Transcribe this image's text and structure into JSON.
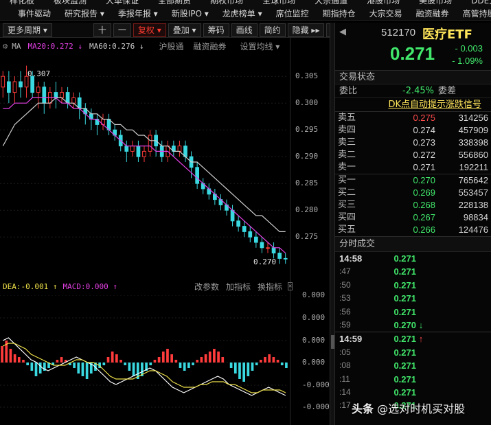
{
  "menu": {
    "row1": [
      "样化板",
      "板块监测",
      "大单保证",
      "全部期货",
      "期权市场",
      "全球市场",
      "大宗通道",
      "港股市场",
      "美股市场",
      "DDE大单"
    ],
    "row2": [
      "事件驱动",
      "研究报告 ▾",
      "季报年报 ▾",
      "新股IPO ▾",
      "龙虎榜单 ▾",
      "席位监控",
      "期指持仓",
      "大宗交易",
      "融资融券",
      "高管持股"
    ]
  },
  "toolbar": {
    "period": "更多周期 ▾",
    "plus": "十",
    "minus": "一",
    "fuquan": "复权 ▾",
    "overlay": "叠加 ▾",
    "chips": "筹码",
    "draw": "画线",
    "simple": "简约",
    "hide": "隐藏 ▸▸",
    "expand": "⛶"
  },
  "ma_legend": {
    "label": "MA",
    "ma20": "MA20:0.272 ↓",
    "ma60": "MA60:0.276 ↓",
    "tabs": [
      "沪股通",
      "融资融券",
      "设置均线 ▾"
    ]
  },
  "kline": {
    "high_label": "0.307",
    "low_label": "0.270",
    "yticks": [
      "0.305",
      "0.300",
      "0.295",
      "0.290",
      "0.285",
      "0.280",
      "0.275"
    ],
    "ma20": [
      0.299,
      0.299,
      0.3,
      0.3,
      0.3,
      0.301,
      0.301,
      0.301,
      0.301,
      0.301,
      0.3,
      0.3,
      0.299,
      0.299,
      0.298,
      0.297,
      0.297,
      0.296,
      0.295,
      0.294,
      0.293,
      0.292,
      0.292,
      0.292,
      0.292,
      0.292,
      0.291,
      0.291,
      0.291,
      0.29,
      0.289,
      0.288,
      0.287,
      0.286,
      0.285,
      0.284,
      0.283,
      0.282,
      0.281,
      0.28,
      0.279,
      0.278,
      0.277,
      0.276,
      0.275,
      0.274,
      0.273,
      0.273,
      0.272
    ],
    "ma60": [
      0.292,
      0.294,
      0.296,
      0.297,
      0.298,
      0.299,
      0.3,
      0.3,
      0.3,
      0.301,
      0.301,
      0.3,
      0.3,
      0.299,
      0.299,
      0.298,
      0.298,
      0.297,
      0.297,
      0.296,
      0.296,
      0.295,
      0.295,
      0.294,
      0.294,
      0.293,
      0.293,
      0.292,
      0.292,
      0.291,
      0.291,
      0.29,
      0.289,
      0.289,
      0.288,
      0.287,
      0.286,
      0.285,
      0.284,
      0.283,
      0.282,
      0.281,
      0.28,
      0.279,
      0.279,
      0.278,
      0.277,
      0.276,
      0.276
    ],
    "candles": [
      [
        0.303,
        0.305,
        0.301,
        0.306,
        0
      ],
      [
        0.304,
        0.302,
        0.3,
        0.306,
        1
      ],
      [
        0.302,
        0.304,
        0.3,
        0.305,
        0
      ],
      [
        0.304,
        0.303,
        0.301,
        0.306,
        1
      ],
      [
        0.303,
        0.305,
        0.301,
        0.307,
        0
      ],
      [
        0.305,
        0.302,
        0.301,
        0.306,
        1
      ],
      [
        0.302,
        0.303,
        0.299,
        0.304,
        0
      ],
      [
        0.303,
        0.3,
        0.298,
        0.304,
        1
      ],
      [
        0.3,
        0.302,
        0.299,
        0.303,
        0
      ],
      [
        0.302,
        0.301,
        0.299,
        0.304,
        1
      ],
      [
        0.301,
        0.302,
        0.3,
        0.303,
        0
      ],
      [
        0.302,
        0.3,
        0.299,
        0.303,
        1
      ],
      [
        0.3,
        0.301,
        0.299,
        0.302,
        0
      ],
      [
        0.301,
        0.299,
        0.297,
        0.302,
        1
      ],
      [
        0.299,
        0.298,
        0.296,
        0.3,
        1
      ],
      [
        0.298,
        0.297,
        0.295,
        0.299,
        1
      ],
      [
        0.297,
        0.296,
        0.294,
        0.298,
        1
      ],
      [
        0.296,
        0.297,
        0.295,
        0.298,
        0
      ],
      [
        0.297,
        0.295,
        0.294,
        0.298,
        1
      ],
      [
        0.295,
        0.294,
        0.293,
        0.296,
        1
      ],
      [
        0.294,
        0.292,
        0.291,
        0.295,
        1
      ],
      [
        0.292,
        0.291,
        0.289,
        0.293,
        1
      ],
      [
        0.291,
        0.292,
        0.29,
        0.293,
        0
      ],
      [
        0.292,
        0.29,
        0.289,
        0.293,
        1
      ],
      [
        0.29,
        0.291,
        0.289,
        0.292,
        0
      ],
      [
        0.291,
        0.294,
        0.29,
        0.295,
        0
      ],
      [
        0.294,
        0.292,
        0.29,
        0.295,
        1
      ],
      [
        0.292,
        0.29,
        0.289,
        0.293,
        1
      ],
      [
        0.29,
        0.292,
        0.289,
        0.293,
        0
      ],
      [
        0.292,
        0.291,
        0.29,
        0.293,
        1
      ],
      [
        0.291,
        0.292,
        0.29,
        0.293,
        0
      ],
      [
        0.292,
        0.29,
        0.289,
        0.293,
        1
      ],
      [
        0.29,
        0.288,
        0.286,
        0.291,
        1
      ],
      [
        0.288,
        0.285,
        0.284,
        0.289,
        1
      ],
      [
        0.285,
        0.284,
        0.283,
        0.286,
        1
      ],
      [
        0.284,
        0.283,
        0.282,
        0.285,
        1
      ],
      [
        0.283,
        0.282,
        0.281,
        0.284,
        1
      ],
      [
        0.282,
        0.281,
        0.28,
        0.283,
        1
      ],
      [
        0.281,
        0.28,
        0.279,
        0.282,
        1
      ],
      [
        0.28,
        0.278,
        0.277,
        0.281,
        1
      ],
      [
        0.278,
        0.277,
        0.276,
        0.279,
        1
      ],
      [
        0.277,
        0.276,
        0.275,
        0.278,
        1
      ],
      [
        0.276,
        0.275,
        0.274,
        0.277,
        1
      ],
      [
        0.275,
        0.274,
        0.273,
        0.276,
        1
      ],
      [
        0.274,
        0.273,
        0.272,
        0.275,
        1
      ],
      [
        0.273,
        0.273,
        0.272,
        0.274,
        0
      ],
      [
        0.273,
        0.272,
        0.271,
        0.274,
        1
      ],
      [
        0.272,
        0.271,
        0.27,
        0.273,
        1
      ],
      [
        0.271,
        0.271,
        0.27,
        0.272,
        1
      ]
    ]
  },
  "macd_legend": {
    "dea": "DEA:-0.001 ↑",
    "macd": "MACD:0.000 ↑",
    "tabs": [
      "改参数",
      "加指标",
      "换指标"
    ],
    "close": "✕"
  },
  "macd": {
    "yticks": [
      "0.000",
      "0.000",
      "0.000",
      "0.000",
      "-0.000",
      "-0.000"
    ],
    "hist": [
      0.6,
      0.8,
      0.5,
      0.3,
      0.2,
      0.1,
      -0.1,
      -0.3,
      -0.5,
      -0.4,
      -0.3,
      -0.2,
      -0.1,
      0.1,
      0.2,
      0.1,
      -0.1,
      -0.2,
      -0.4,
      -0.5,
      -0.6,
      -0.4,
      -0.3,
      -0.2,
      -0.1,
      0.2,
      0.4,
      0.3,
      0.1,
      -0.1,
      -0.3,
      -0.5,
      -0.6,
      -0.5,
      -0.3,
      -0.1,
      0.1,
      0.2,
      0.4,
      0.5,
      0.3,
      0.1,
      -0.2,
      -0.3,
      -0.2,
      -0.1,
      0.1,
      0.2,
      0.3,
      0.4,
      0.5,
      0.4,
      0.2,
      0.0,
      -0.2,
      -0.4,
      -0.6,
      -0.7,
      -0.5,
      -0.3,
      -0.1,
      0.1,
      0.2,
      0.3,
      0.2,
      0.1,
      -0.1,
      -0.2
    ],
    "dif": [
      0.8,
      0.9,
      0.7,
      0.5,
      0.3,
      0.1,
      0.0,
      -0.2,
      -0.3,
      -0.2,
      -0.1,
      0.0,
      0.1,
      0.2,
      0.1,
      0.0,
      -0.1,
      -0.3,
      -0.5,
      -0.7,
      -0.8,
      -0.7,
      -0.6,
      -0.5,
      -0.4,
      -0.3,
      -0.2,
      -0.3,
      -0.5,
      -0.7,
      -0.9,
      -1.0,
      -1.1,
      -1.0,
      -0.9,
      -0.8,
      -0.7,
      -0.6,
      -0.5,
      -0.6,
      -0.8,
      -0.9,
      -1.0,
      -1.1,
      -1.2,
      -1.1,
      -1.0,
      -0.9,
      -1.0,
      -1.1,
      -1.2
    ],
    "dea_line": [
      0.6,
      0.7,
      0.7,
      0.6,
      0.5,
      0.3,
      0.2,
      0.1,
      0.0,
      -0.1,
      -0.1,
      -0.1,
      0.0,
      0.1,
      0.1,
      0.0,
      0.0,
      -0.1,
      -0.3,
      -0.5,
      -0.6,
      -0.6,
      -0.6,
      -0.6,
      -0.5,
      -0.4,
      -0.3,
      -0.3,
      -0.4,
      -0.5,
      -0.7,
      -0.8,
      -0.9,
      -0.9,
      -0.9,
      -0.8,
      -0.8,
      -0.7,
      -0.7,
      -0.7,
      -0.8,
      -0.8,
      -0.9,
      -1.0,
      -1.1,
      -1.1,
      -1.0,
      -1.0,
      -1.0,
      -1.0,
      -1.1
    ]
  },
  "quote": {
    "back": "◀",
    "code": "512170",
    "name": "医疗ETF",
    "price": "0.271",
    "change": "- 0.003",
    "change_pct": "- 1.09%"
  },
  "status": {
    "title": "交易状态",
    "ratio_label": "委比",
    "ratio_value": "-2.45%",
    "diff_label": "委差",
    "dk": "DK点自动提示涨跌信号"
  },
  "asks": [
    {
      "label": "卖五",
      "price": "0.275",
      "vol": "314256",
      "up": true
    },
    {
      "label": "卖四",
      "price": "0.274",
      "vol": "457909",
      "up": false
    },
    {
      "label": "卖三",
      "price": "0.273",
      "vol": "338398",
      "up": false
    },
    {
      "label": "卖二",
      "price": "0.272",
      "vol": "556860",
      "up": false
    },
    {
      "label": "卖一",
      "price": "0.271",
      "vol": "192211",
      "up": false
    }
  ],
  "bids": [
    {
      "label": "买一",
      "price": "0.270",
      "vol": "765642"
    },
    {
      "label": "买二",
      "price": "0.269",
      "vol": "553457"
    },
    {
      "label": "买三",
      "price": "0.268",
      "vol": "228138"
    },
    {
      "label": "买四",
      "price": "0.267",
      "vol": "98834"
    },
    {
      "label": "买五",
      "price": "0.266",
      "vol": "124476"
    }
  ],
  "ticks": {
    "title": "分时成交",
    "rows": [
      {
        "time": "14:58",
        "price": "0.271",
        "arrow": "",
        "major": true
      },
      {
        "time": ":47",
        "price": "0.271",
        "arrow": ""
      },
      {
        "time": ":50",
        "price": "0.271",
        "arrow": ""
      },
      {
        "time": ":53",
        "price": "0.271",
        "arrow": ""
      },
      {
        "time": ":56",
        "price": "0.271",
        "arrow": ""
      },
      {
        "time": ":59",
        "price": "0.270",
        "arrow": "↓",
        "dir": "down"
      },
      {
        "time": "14:59",
        "price": "0.271",
        "arrow": "↑",
        "dir": "up",
        "major": true
      },
      {
        "time": ":05",
        "price": "0.271",
        "arrow": ""
      },
      {
        "time": ":08",
        "price": "0.271",
        "arrow": ""
      },
      {
        "time": ":11",
        "price": "0.271",
        "arrow": ""
      },
      {
        "time": ":14",
        "price": "0.271",
        "arrow": ""
      },
      {
        "time": ":17",
        "price": "0.271",
        "arrow": ""
      }
    ]
  },
  "watermark": {
    "brand": "头条",
    "text": "@选对时机买对股"
  },
  "colors": {
    "up": "#ff3b3b",
    "down": "#3ad8e0",
    "ma20": "#e440e4",
    "ma60": "#cfcfcf",
    "dea": "#f0e24a",
    "price_green": "#41e86b"
  }
}
